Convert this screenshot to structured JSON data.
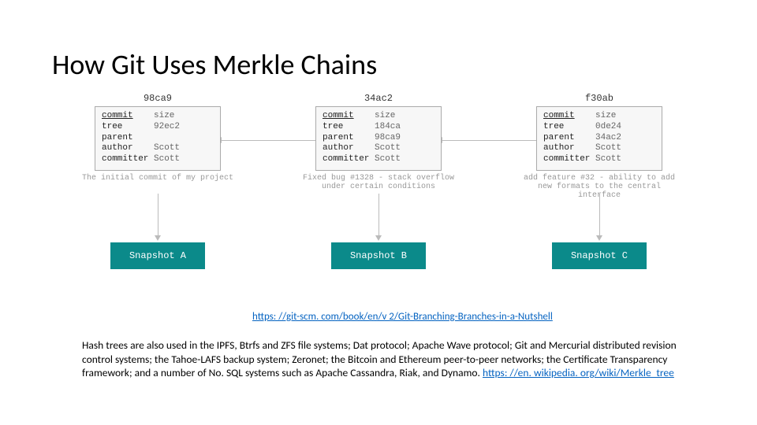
{
  "title": "How Git Uses Merkle Chains",
  "commits": [
    {
      "hash": "98ca9",
      "fields": {
        "commit_label": "commit",
        "size_label": "size",
        "tree_label": "tree",
        "tree_val": "92ec2",
        "parent_label": "parent",
        "parent_val": "",
        "author_label": "author",
        "author_val": "Scott",
        "committer_label": "committer",
        "committer_val": "Scott"
      },
      "message": "The initial commit of my project",
      "snapshot": "Snapshot A"
    },
    {
      "hash": "34ac2",
      "fields": {
        "commit_label": "commit",
        "size_label": "size",
        "tree_label": "tree",
        "tree_val": "184ca",
        "parent_label": "parent",
        "parent_val": "98ca9",
        "author_label": "author",
        "author_val": "Scott",
        "committer_label": "committer",
        "committer_val": "Scott"
      },
      "message": "Fixed bug #1328 - stack overflow under certain conditions",
      "snapshot": "Snapshot B"
    },
    {
      "hash": "f30ab",
      "fields": {
        "commit_label": "commit",
        "size_label": "size",
        "tree_label": "tree",
        "tree_val": "0de24",
        "parent_label": "parent",
        "parent_val": "34ac2",
        "author_label": "author",
        "author_val": "Scott",
        "committer_label": "committer",
        "committer_val": "Scott"
      },
      "message": "add feature #32 - ability to add new formats to the central interface",
      "snapshot": "Snapshot C"
    }
  ],
  "link1": "https: //git-scm. com/book/en/v 2/Git-Branching-Branches-in-a-Nutshell",
  "body_parts": {
    "p1": "Hash trees are also used in the IPFS, Btrfs and ZFS file systems; Dat protocol; Apache Wave protocol; Git and Mercurial distributed revision control systems; the Tahoe-LAFS backup system; Zeronet; the Bitcoin and Ethereum peer-to-peer networks; the Certificate Transparency framework; and a number of No. SQL systems such as Apache Cassandra, Riak, and Dynamo. ",
    "link2": "https: //en. wikipedia. org/wiki/Merkle_tree"
  }
}
